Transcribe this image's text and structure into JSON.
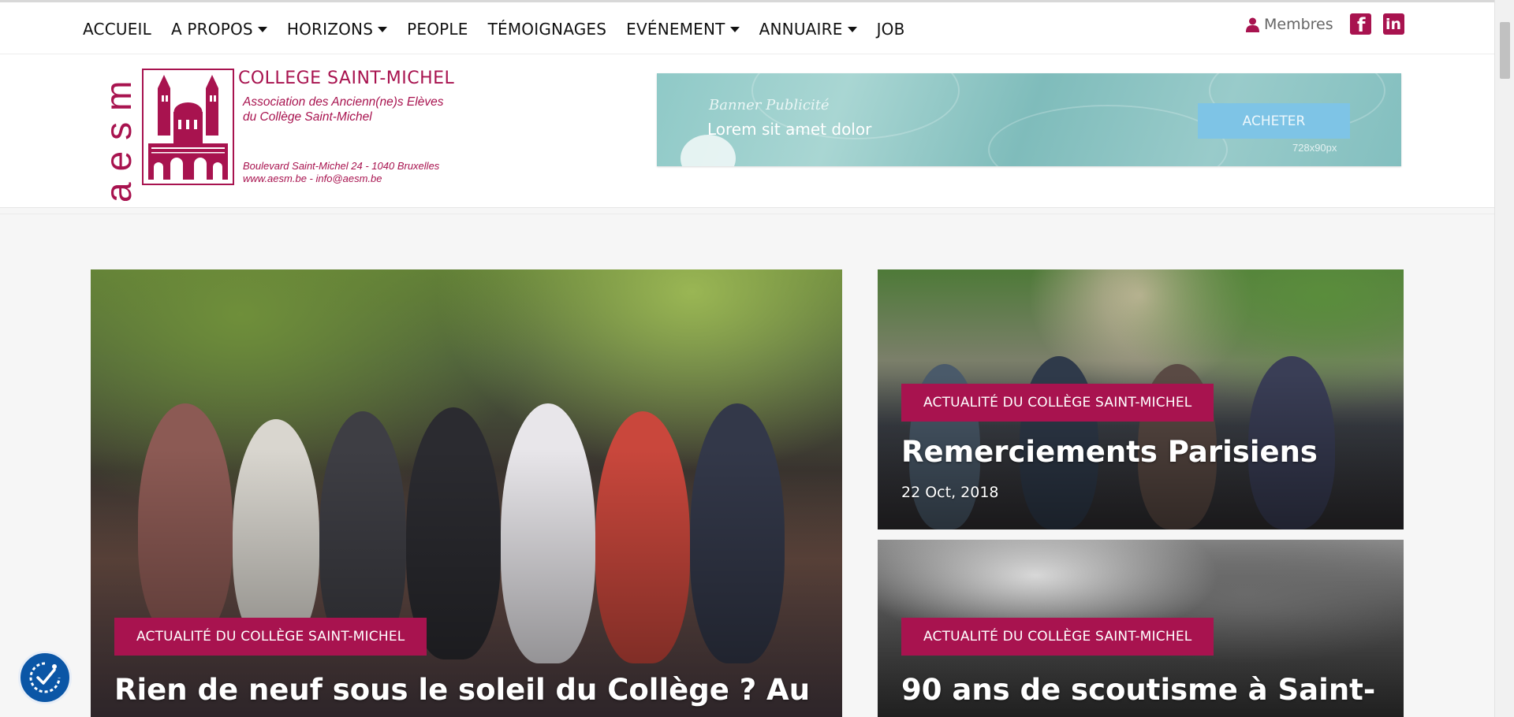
{
  "nav": {
    "items": [
      {
        "label": "ACCUEIL",
        "dropdown": false
      },
      {
        "label": "A PROPOS",
        "dropdown": true
      },
      {
        "label": "HORIZONS",
        "dropdown": true
      },
      {
        "label": "PEOPLE",
        "dropdown": false
      },
      {
        "label": "TÉMOIGNAGES",
        "dropdown": false
      },
      {
        "label": "EVÉNEMENT",
        "dropdown": true
      },
      {
        "label": "ANNUAIRE",
        "dropdown": true
      },
      {
        "label": "JOB",
        "dropdown": false
      }
    ],
    "members_label": "Membres",
    "social": {
      "facebook_icon": "facebook-icon",
      "linkedin_icon": "linkedin-icon"
    }
  },
  "logo": {
    "acronym": "aesm",
    "college": "COLLEGE SAINT-MICHEL",
    "assoc_line1": "Association des Ancienn(ne)s Elèves",
    "assoc_line2": "du Collège Saint-Michel",
    "address": "Boulevard Saint-Michel 24 - 1040 Bruxelles",
    "contact": "www.aesm.be - info@aesm.be"
  },
  "banner": {
    "label": "Banner Publicité",
    "text": "Lorem sit amet dolor",
    "button": "ACHETER",
    "size": "728x90px"
  },
  "cards": [
    {
      "tag": "ACTUALITÉ DU COLLÈGE SAINT-MICHEL",
      "title": "Rien de neuf sous le soleil du Collège ? Au",
      "date": ""
    },
    {
      "tag": "ACTUALITÉ DU COLLÈGE SAINT-MICHEL",
      "title": "Remerciements Parisiens",
      "date": "22 Oct, 2018"
    },
    {
      "tag": "ACTUALITÉ DU COLLÈGE SAINT-MICHEL",
      "title": "90 ans de scoutisme à Saint-",
      "date": ""
    }
  ],
  "colors": {
    "brand": "#a8134f",
    "accessibility": "#0b56a6"
  },
  "icons": {
    "members": "user-icon",
    "accessibility": "accessibility-icon"
  }
}
